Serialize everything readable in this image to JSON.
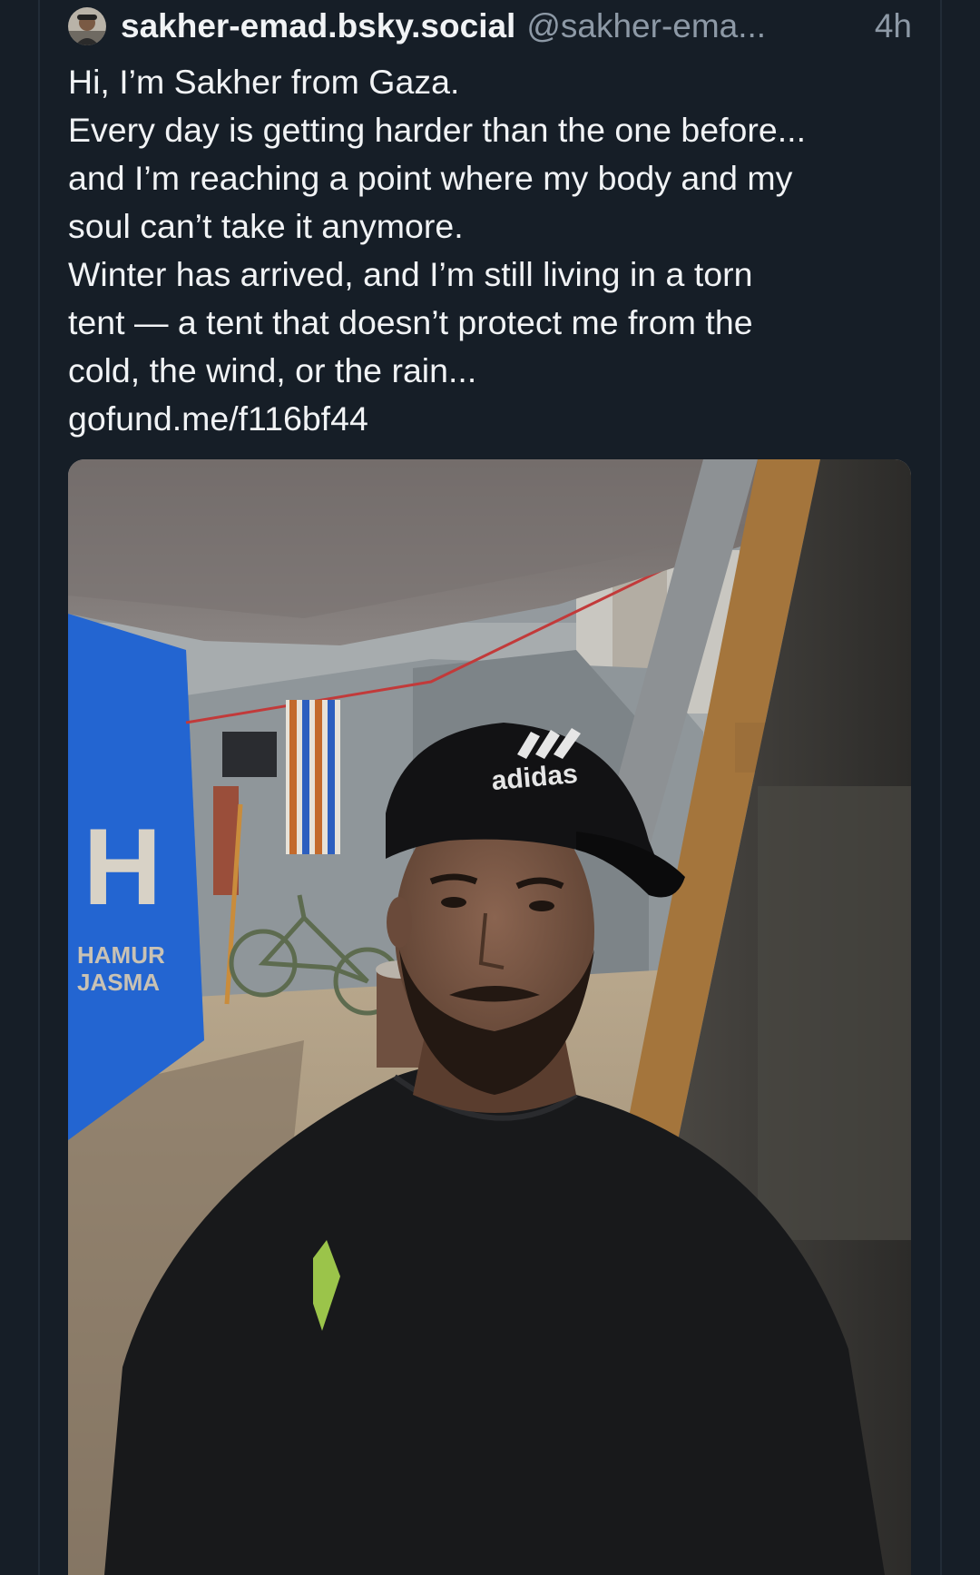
{
  "post": {
    "author": {
      "display_name": "sakher-emad.bsky.social",
      "handle": "@sakher-ema...",
      "avatar_icon": "avatar-photo"
    },
    "timestamp": "4h",
    "text_lines": [
      "Hi, I’m Sakher from Gaza.",
      "Every day is getting harder than the one before...",
      "and I’m reaching a point where my body and my",
      "soul can’t take it anymore.",
      "Winter has arrived, and I’m still living in a torn",
      "tent — a tent that doesn’t protect me from the",
      "cold, the wind, or the rain..."
    ],
    "link_text": "gofund.me/f116bf44",
    "image": {
      "description_icon": "selfie-in-tent-photo",
      "cap_text": "adidas",
      "tent_sign_letter": "H",
      "tent_sign_lines": [
        "HAMUR",
        "JASMA"
      ]
    }
  },
  "colors": {
    "background": "#161e27",
    "text_primary": "#f1f3f5",
    "text_secondary": "#8d99a6",
    "rail": "#222c37"
  }
}
